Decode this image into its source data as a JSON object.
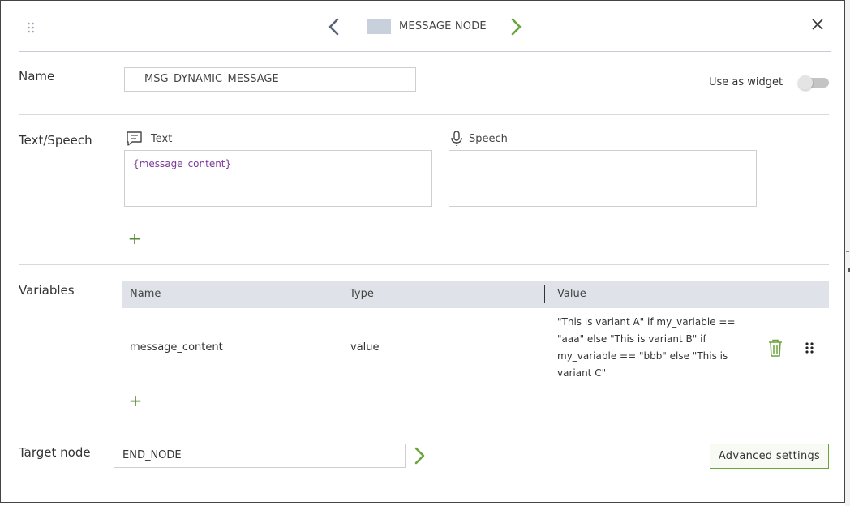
{
  "header": {
    "title": "MESSAGE NODE",
    "icons": {
      "drag": "drag-dots-icon",
      "prev": "chevron-left-icon",
      "next": "chevron-right-icon",
      "close": "close-icon"
    }
  },
  "colors": {
    "accent_green": "#6aa43a",
    "swatch": "#c8d0dc",
    "variable_text": "#7a3a96",
    "table_header_bg": "#dfe3e9"
  },
  "name_section": {
    "label": "Name",
    "value": "MSG_DYNAMIC_MESSAGE",
    "widget_label": "Use as widget",
    "widget_enabled": false
  },
  "text_speech": {
    "label": "Text/Speech",
    "text_label": "Text",
    "text_value": "{message_content}",
    "speech_label": "Speech",
    "speech_value": "",
    "add_symbol": "+"
  },
  "variables": {
    "label": "Variables",
    "columns": [
      "Name",
      "Type",
      "Value"
    ],
    "rows": [
      {
        "name": "message_content",
        "type": "value",
        "value": "\"This is variant A\" if my_variable == \"aaa\" else \"This is variant B\" if my_variable == \"bbb\" else \"This is variant C\""
      }
    ],
    "add_symbol": "+"
  },
  "target": {
    "label": "Target node",
    "value": "END_NODE",
    "advanced_label": "Advanced settings"
  }
}
